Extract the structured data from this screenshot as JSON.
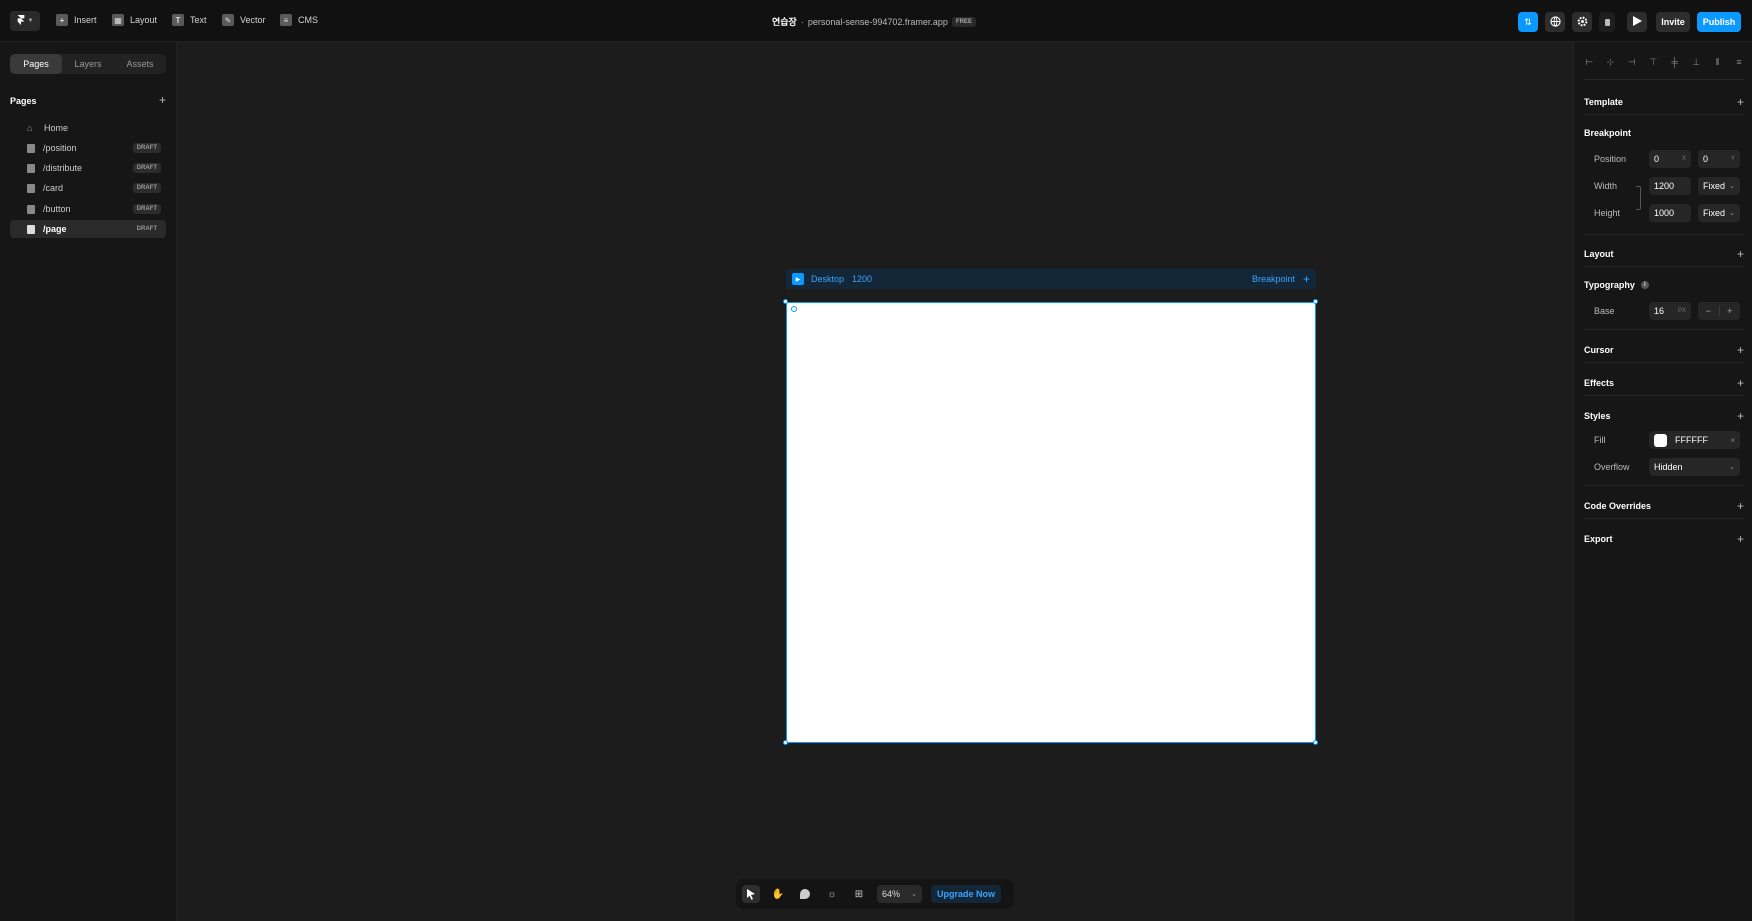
{
  "topbar": {
    "tools": [
      {
        "label": "Insert",
        "icon": "plus-icon"
      },
      {
        "label": "Layout",
        "icon": "layout-icon"
      },
      {
        "label": "Text",
        "icon": "text-icon"
      },
      {
        "label": "Vector",
        "icon": "vector-icon"
      },
      {
        "label": "CMS",
        "icon": "cms-icon"
      }
    ],
    "project_name": "연습장",
    "separator": "·",
    "domain": "personal-sense-994702.framer.app",
    "plan_badge": "FREE",
    "invite_label": "Invite",
    "publish_label": "Publish"
  },
  "left_panel": {
    "tabs": [
      "Pages",
      "Layers",
      "Assets"
    ],
    "active_tab": "Pages",
    "section_title": "Pages",
    "pages": [
      {
        "label": "Home",
        "badge": ""
      },
      {
        "label": "/position",
        "badge": "DRAFT"
      },
      {
        "label": "/distribute",
        "badge": "DRAFT"
      },
      {
        "label": "/card",
        "badge": "DRAFT"
      },
      {
        "label": "/button",
        "badge": "DRAFT"
      },
      {
        "label": "/page",
        "badge": "DRAFT"
      }
    ],
    "selected_page": "/page"
  },
  "canvas": {
    "frame_name": "Desktop",
    "frame_width": "1200",
    "breakpoint_label": "Breakpoint",
    "frame_fill": "#FFFFFF"
  },
  "bottom_toolbar": {
    "zoom": "64%",
    "upgrade_label": "Upgrade Now"
  },
  "right_panel": {
    "sections": {
      "template": "Template",
      "breakpoint": "Breakpoint",
      "layout": "Layout",
      "typography": "Typography",
      "cursor": "Cursor",
      "effects": "Effects",
      "styles": "Styles",
      "code_overrides": "Code Overrides",
      "export": "Export"
    },
    "position_label": "Position",
    "position_x": "0",
    "position_x_unit": "X",
    "position_y": "0",
    "position_y_unit": "Y",
    "width_label": "Width",
    "width_value": "1200",
    "width_mode": "Fixed",
    "height_label": "Height",
    "height_value": "1000",
    "height_mode": "Fixed",
    "base_label": "Base",
    "base_value": "16",
    "base_unit": "PX",
    "fill_label": "Fill",
    "fill_value": "FFFFFF",
    "overflow_label": "Overflow",
    "overflow_value": "Hidden"
  },
  "colors": {
    "accent": "#0b99ff",
    "background": "#1b1b1b",
    "panel": "#161616"
  }
}
